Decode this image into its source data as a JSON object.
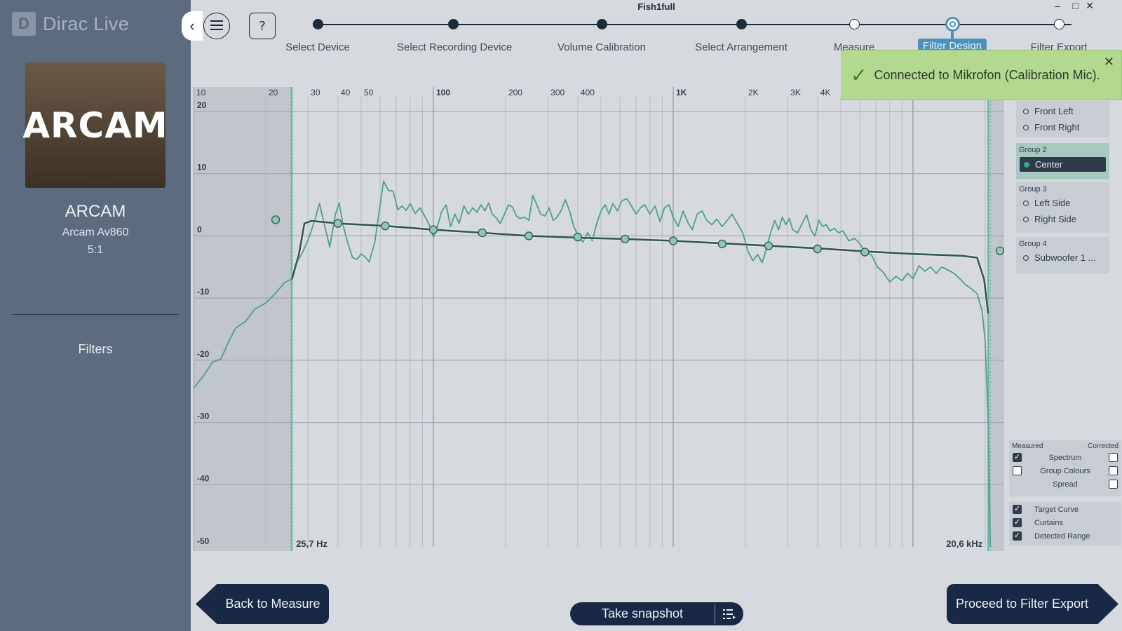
{
  "window": {
    "title": "Fish1full",
    "minimize": "–",
    "maximize": "□",
    "close": "✕"
  },
  "sidebar": {
    "brand": "Dirac Live",
    "brand_logo": "D",
    "product_image_text": "ARCAM",
    "product_name": "ARCAM",
    "product_model": "Arcam Av860",
    "product_config": "5:1",
    "menu": [
      {
        "label": "Filters"
      }
    ]
  },
  "toolbar": {
    "menu_icon": "☰",
    "help_label": "?",
    "collapse_icon": "‹"
  },
  "steps": [
    {
      "label": "Select Device",
      "state": "done"
    },
    {
      "label": "Select Recording Device",
      "state": "done"
    },
    {
      "label": "Volume Calibration",
      "state": "done"
    },
    {
      "label": "Select Arrangement",
      "state": "done"
    },
    {
      "label": "Measure",
      "state": "open"
    },
    {
      "label": "Filter Design",
      "state": "active"
    },
    {
      "label": "Filter Export",
      "state": "open"
    }
  ],
  "toast": {
    "message": "Connected to Mikrofon (Calibration Mic).",
    "close": "✕",
    "icon": "check-icon"
  },
  "groups": [
    {
      "title": "",
      "speakers": [
        {
          "label": "Front Left"
        },
        {
          "label": "Front Right"
        }
      ]
    },
    {
      "title": "Group 2",
      "speakers": [
        {
          "label": "Center",
          "selected": true
        }
      ]
    },
    {
      "title": "Group 3",
      "speakers": [
        {
          "label": "Left Side"
        },
        {
          "label": "Right Side"
        }
      ]
    },
    {
      "title": "Group 4",
      "speakers": [
        {
          "label": "Subwoofer 1 ..."
        }
      ]
    }
  ],
  "legend": {
    "head_left": "Measured",
    "head_right": "Corrected",
    "rows": [
      {
        "label": "Spectrum",
        "measured": true,
        "corrected": false
      },
      {
        "label": "Group Colours",
        "measured": false,
        "corrected": false
      },
      {
        "label": "Spread",
        "corrected": false
      }
    ],
    "options": [
      {
        "label": "Target Curve",
        "checked": true
      },
      {
        "label": "Curtains",
        "checked": true
      },
      {
        "label": "Detected Range",
        "checked": true
      }
    ]
  },
  "buttons": {
    "back": "Back to Measure",
    "next": "Proceed to Filter Export",
    "snapshot": "Take snapshot"
  },
  "colors": {
    "measured": "#4d9f8c",
    "target": "#34574d",
    "accent": "#4d91be",
    "dark": "#182845"
  },
  "chart_data": {
    "type": "line",
    "x_scale": "log",
    "xlim": [
      10,
      24000
    ],
    "ylim": [
      -50,
      20
    ],
    "x_tick_labels": [
      {
        "v": 10,
        "t": "10"
      },
      {
        "v": 20,
        "t": "20"
      },
      {
        "v": 30,
        "t": "30"
      },
      {
        "v": 40,
        "t": "40"
      },
      {
        "v": 50,
        "t": "50"
      },
      {
        "v": 100,
        "t": "100",
        "major": true
      },
      {
        "v": 200,
        "t": "200"
      },
      {
        "v": 300,
        "t": "300"
      },
      {
        "v": 400,
        "t": "400"
      },
      {
        "v": 1000,
        "t": "1K",
        "major": true
      },
      {
        "v": 2000,
        "t": "2K"
      },
      {
        "v": 3000,
        "t": "3K"
      },
      {
        "v": 4000,
        "t": "4K"
      }
    ],
    "y_ticks": [
      20,
      10,
      0,
      -10,
      -20,
      -30,
      -40,
      -50
    ],
    "curtain_low": 25.7,
    "curtain_high": 20600,
    "curtain_low_label": "25,7 Hz",
    "curtain_high_label": "20,6 kHz",
    "target_curve": [
      [
        25.7,
        -7.0
      ],
      [
        27.5,
        -3.0
      ],
      [
        29,
        2.0
      ],
      [
        31,
        2.4
      ],
      [
        40,
        2.0
      ],
      [
        63,
        1.6
      ],
      [
        100,
        1.0
      ],
      [
        160,
        0.5
      ],
      [
        250,
        0.0
      ],
      [
        400,
        -0.3
      ],
      [
        630,
        -0.5
      ],
      [
        1000,
        -0.8
      ],
      [
        1600,
        -1.2
      ],
      [
        2500,
        -1.6
      ],
      [
        4000,
        -2.0
      ],
      [
        6300,
        -2.5
      ],
      [
        10000,
        -2.9
      ],
      [
        16000,
        -3.2
      ],
      [
        18500,
        -3.5
      ],
      [
        19800,
        -7.0
      ],
      [
        20600,
        -12.5
      ]
    ],
    "target_handles": [
      [
        22,
        2.6
      ],
      [
        40,
        2.0
      ],
      [
        63,
        1.6
      ],
      [
        100,
        1.0
      ],
      [
        160,
        0.5
      ],
      [
        250,
        0.0
      ],
      [
        400,
        -0.2
      ],
      [
        630,
        -0.5
      ],
      [
        1000,
        -0.8
      ],
      [
        1600,
        -1.3
      ],
      [
        2500,
        -1.6
      ],
      [
        4000,
        -2.1
      ],
      [
        6300,
        -2.6
      ],
      [
        23500,
        -2.4
      ]
    ],
    "measured_curve": [
      [
        10,
        -24.5
      ],
      [
        11,
        -22.5
      ],
      [
        12,
        -20.3
      ],
      [
        13,
        -19.8
      ],
      [
        14,
        -17.0
      ],
      [
        15,
        -14.8
      ],
      [
        16.5,
        -13.7
      ],
      [
        18,
        -11.8
      ],
      [
        20,
        -10.8
      ],
      [
        22,
        -9.2
      ],
      [
        24,
        -7.5
      ],
      [
        25.7,
        -6.9
      ],
      [
        27,
        -4.3
      ],
      [
        28.5,
        -2.6
      ],
      [
        30,
        -0.7
      ],
      [
        32,
        2.5
      ],
      [
        33.5,
        5.2
      ],
      [
        35,
        2.0
      ],
      [
        37,
        -1.8
      ],
      [
        39,
        3.4
      ],
      [
        40.5,
        5.3
      ],
      [
        42,
        1.8
      ],
      [
        44,
        -1.2
      ],
      [
        46,
        -3.5
      ],
      [
        48,
        -3.8
      ],
      [
        50,
        -2.9
      ],
      [
        52,
        -3.4
      ],
      [
        54,
        -4.2
      ],
      [
        57,
        -1.0
      ],
      [
        60,
        5.0
      ],
      [
        62,
        8.8
      ],
      [
        65,
        7.3
      ],
      [
        68,
        7.2
      ],
      [
        71,
        4.2
      ],
      [
        74,
        4.8
      ],
      [
        77,
        4.1
      ],
      [
        80,
        5.2
      ],
      [
        84,
        3.6
      ],
      [
        88,
        4.5
      ],
      [
        92,
        3.2
      ],
      [
        96,
        1.8
      ],
      [
        100,
        -0.2
      ],
      [
        104,
        1.5
      ],
      [
        108,
        3.8
      ],
      [
        113,
        5.0
      ],
      [
        118,
        1.5
      ],
      [
        123,
        3.5
      ],
      [
        128,
        2.0
      ],
      [
        134,
        4.8
      ],
      [
        140,
        3.5
      ],
      [
        146,
        4.5
      ],
      [
        152,
        3.8
      ],
      [
        158,
        5.0
      ],
      [
        164,
        4.0
      ],
      [
        170,
        5.3
      ],
      [
        176,
        3.5
      ],
      [
        182,
        3.0
      ],
      [
        190,
        2.0
      ],
      [
        198,
        3.5
      ],
      [
        206,
        5.0
      ],
      [
        214,
        4.6
      ],
      [
        222,
        3.2
      ],
      [
        230,
        2.8
      ],
      [
        240,
        3.0
      ],
      [
        250,
        2.5
      ],
      [
        260,
        6.5
      ],
      [
        270,
        5.0
      ],
      [
        280,
        3.5
      ],
      [
        292,
        3.2
      ],
      [
        304,
        4.5
      ],
      [
        316,
        2.5
      ],
      [
        328,
        3.0
      ],
      [
        340,
        4.0
      ],
      [
        355,
        5.8
      ],
      [
        370,
        4.0
      ],
      [
        385,
        1.5
      ],
      [
        400,
        0.2
      ],
      [
        420,
        -1.0
      ],
      [
        440,
        0.5
      ],
      [
        460,
        -0.8
      ],
      [
        480,
        2.0
      ],
      [
        500,
        4.0
      ],
      [
        520,
        5.0
      ],
      [
        540,
        3.5
      ],
      [
        560,
        5.2
      ],
      [
        585,
        4.0
      ],
      [
        610,
        5.6
      ],
      [
        640,
        6.0
      ],
      [
        670,
        4.8
      ],
      [
        700,
        3.5
      ],
      [
        730,
        4.5
      ],
      [
        760,
        5.0
      ],
      [
        800,
        3.5
      ],
      [
        840,
        4.8
      ],
      [
        880,
        2.3
      ],
      [
        920,
        4.5
      ],
      [
        960,
        5.0
      ],
      [
        1000,
        3.0
      ],
      [
        1050,
        1.5
      ],
      [
        1100,
        4.0
      ],
      [
        1150,
        2.2
      ],
      [
        1200,
        1.0
      ],
      [
        1260,
        3.5
      ],
      [
        1320,
        4.0
      ],
      [
        1380,
        2.5
      ],
      [
        1450,
        1.8
      ],
      [
        1520,
        2.7
      ],
      [
        1600,
        1.5
      ],
      [
        1680,
        2.5
      ],
      [
        1760,
        3.5
      ],
      [
        1850,
        2.0
      ],
      [
        1950,
        0.5
      ],
      [
        2050,
        -2.5
      ],
      [
        2150,
        -4.0
      ],
      [
        2250,
        -3.0
      ],
      [
        2350,
        -4.3
      ],
      [
        2450,
        -2.0
      ],
      [
        2550,
        0.5
      ],
      [
        2650,
        2.5
      ],
      [
        2750,
        1.0
      ],
      [
        2850,
        3.0
      ],
      [
        2950,
        1.8
      ],
      [
        3050,
        2.8
      ],
      [
        3150,
        1.0
      ],
      [
        3300,
        0.5
      ],
      [
        3450,
        2.0
      ],
      [
        3600,
        3.4
      ],
      [
        3750,
        1.0
      ],
      [
        3900,
        0.0
      ],
      [
        4050,
        2.5
      ],
      [
        4200,
        1.5
      ],
      [
        4350,
        1.8
      ],
      [
        4500,
        0.8
      ],
      [
        4700,
        1.2
      ],
      [
        4900,
        0.5
      ],
      [
        5100,
        0.8
      ],
      [
        5400,
        -0.8
      ],
      [
        5700,
        -0.4
      ],
      [
        6000,
        -1.2
      ],
      [
        6300,
        -2.7
      ],
      [
        6700,
        -3.0
      ],
      [
        7100,
        -5.0
      ],
      [
        7500,
        -5.8
      ],
      [
        8000,
        -7.4
      ],
      [
        8500,
        -6.5
      ],
      [
        9000,
        -7.2
      ],
      [
        9500,
        -6.0
      ],
      [
        10000,
        -6.9
      ],
      [
        10600,
        -4.8
      ],
      [
        11200,
        -5.7
      ],
      [
        11800,
        -5.0
      ],
      [
        12500,
        -6.0
      ],
      [
        13200,
        -5.0
      ],
      [
        14000,
        -5.5
      ],
      [
        14800,
        -6.0
      ],
      [
        15600,
        -6.8
      ],
      [
        16500,
        -7.8
      ],
      [
        17500,
        -8.5
      ],
      [
        18500,
        -9.3
      ],
      [
        19400,
        -12.0
      ],
      [
        20000,
        -17.0
      ],
      [
        20600,
        -30.0
      ],
      [
        21000,
        -50.0
      ]
    ]
  }
}
